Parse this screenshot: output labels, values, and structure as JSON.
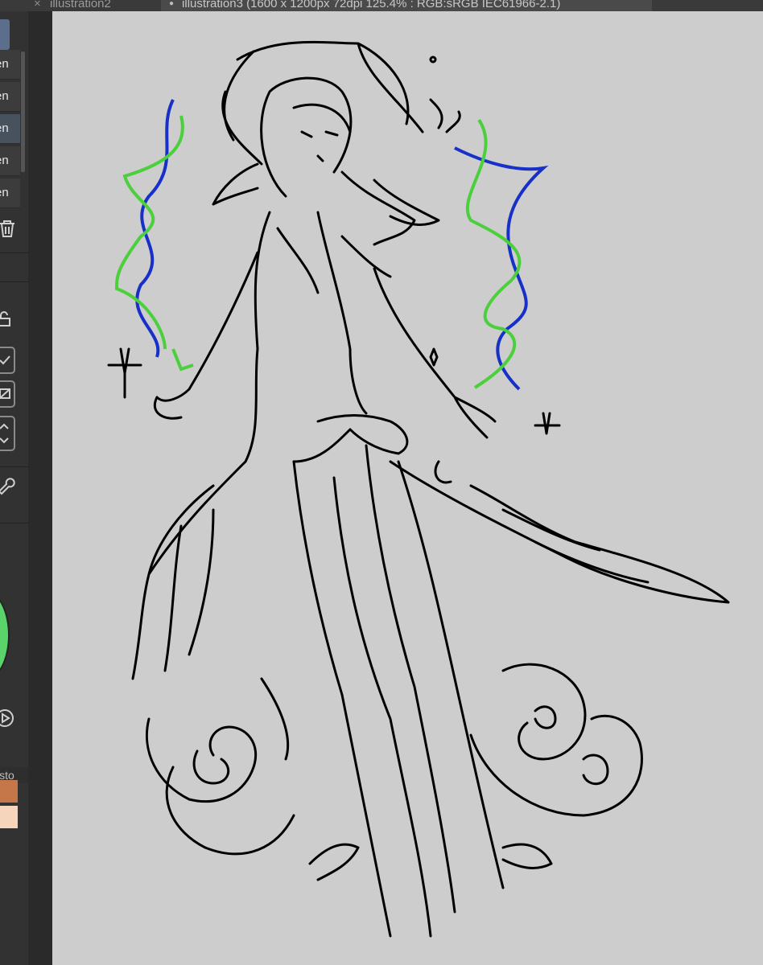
{
  "tabs": [
    {
      "label": "illustration2",
      "close_icon": "×"
    },
    {
      "label": "illustration3  (1600 x 1200px 72dpi 125.4% : RGB:sRGB IEC61966-2.1)",
      "active": true
    }
  ],
  "layers": [
    {
      "label": "en"
    },
    {
      "label": "en"
    },
    {
      "label": "en",
      "selected": true
    },
    {
      "label": "en"
    },
    {
      "label": "en"
    }
  ],
  "history_tab": {
    "label": "isto"
  },
  "colors": {
    "canvas_bg": "#cdcdcd",
    "line": "#000000",
    "green_stroke": "#4ccf3c",
    "blue_stroke": "#1630c8",
    "main_color": "#5ad36b",
    "swatch_1": "#c6774a",
    "swatch_2": "#f6d5bd"
  },
  "icons": [
    "close-icon",
    "trash-icon",
    "lock-icon",
    "check-icon",
    "mask-icon",
    "chevron-up-icon",
    "chevron-down-icon",
    "wrench-icon",
    "play-icon"
  ]
}
